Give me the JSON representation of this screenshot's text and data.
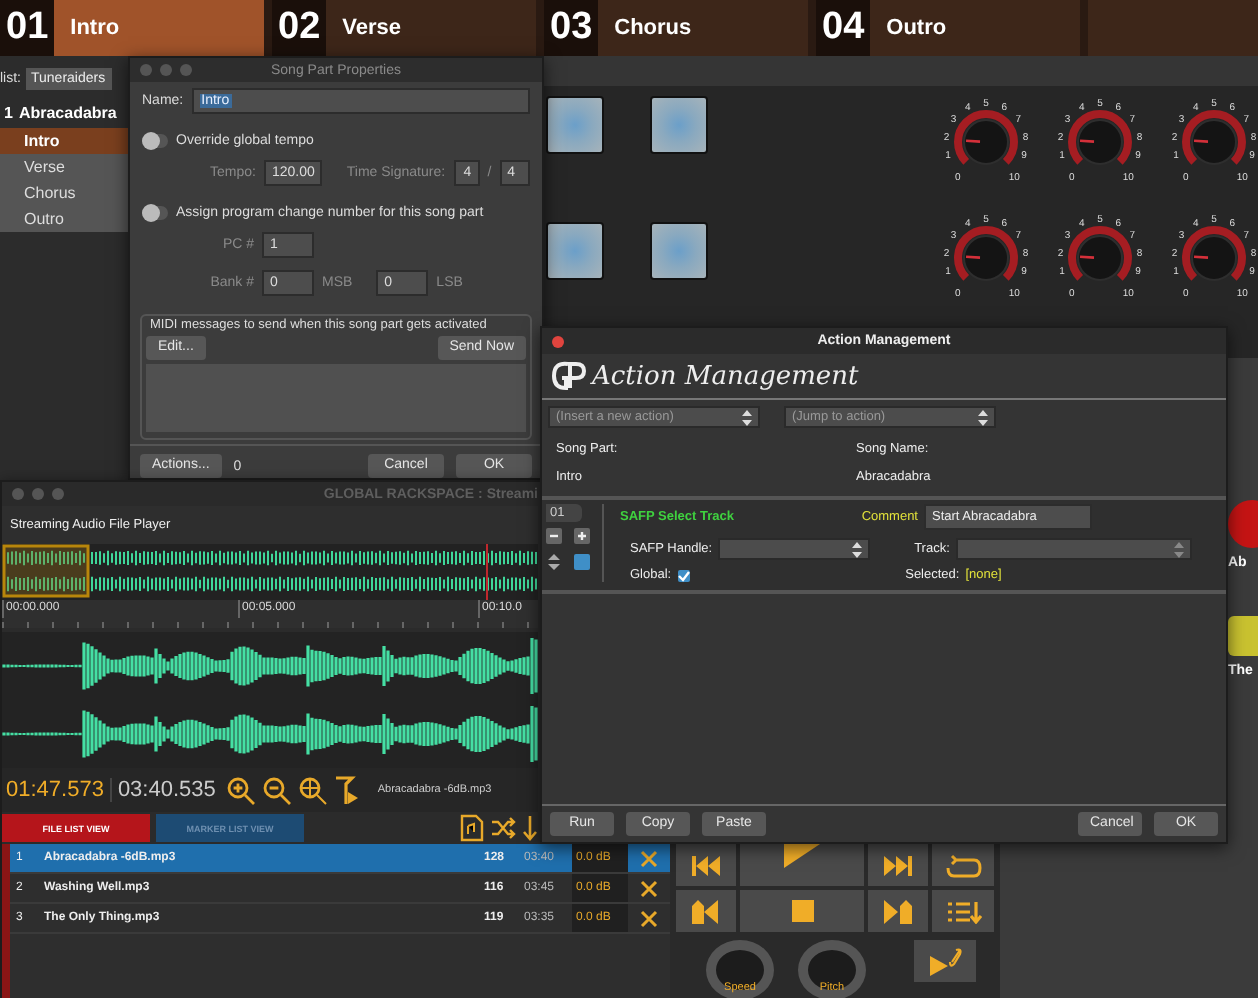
{
  "song_parts": [
    {
      "number": "01",
      "name": "Intro",
      "selected": true
    },
    {
      "number": "02",
      "name": "Verse",
      "selected": false
    },
    {
      "number": "03",
      "name": "Chorus",
      "selected": false
    },
    {
      "number": "04",
      "name": "Outro",
      "selected": false
    }
  ],
  "setlist": {
    "label": "list:",
    "value": "Tuneraiders",
    "song_number": "1",
    "song_name": "Abracadabra",
    "parts": [
      {
        "name": "Intro",
        "selected": true
      },
      {
        "name": "Verse",
        "selected": false
      },
      {
        "name": "Chorus",
        "selected": false
      },
      {
        "name": "Outro",
        "selected": false
      }
    ]
  },
  "knobs": [
    {
      "scale": [
        "0",
        "1",
        "2",
        "3",
        "4",
        "5",
        "6",
        "7",
        "8",
        "9",
        "10"
      ]
    },
    {
      "scale": [
        "0",
        "1",
        "2",
        "3",
        "4",
        "5",
        "6",
        "7",
        "8",
        "9",
        "10"
      ]
    },
    {
      "scale": [
        "0",
        "1",
        "2",
        "3",
        "4",
        "5",
        "6",
        "7",
        "8",
        "9",
        "10"
      ]
    },
    {
      "scale": [
        "0",
        "1",
        "2",
        "3",
        "4",
        "5",
        "6",
        "7",
        "8",
        "9",
        "10"
      ]
    },
    {
      "scale": [
        "0",
        "1",
        "2",
        "3",
        "4",
        "5",
        "6",
        "7",
        "8",
        "9",
        "10"
      ]
    },
    {
      "scale": [
        "0",
        "1",
        "2",
        "3",
        "4",
        "5",
        "6",
        "7",
        "8",
        "9",
        "10"
      ]
    }
  ],
  "side_buttons": [
    {
      "label": "Ab",
      "color": "#c41414"
    },
    {
      "label": "The",
      "color": "#c9c230"
    }
  ],
  "song_part_dialog": {
    "title": "Song Part Properties",
    "name_label": "Name:",
    "name_value": "Intro",
    "override_tempo": {
      "label": "Override global tempo",
      "on": false
    },
    "tempo_label": "Tempo:",
    "tempo": "120.00",
    "time_signature_label": "Time Signature:",
    "ts_numerator": "4",
    "ts_separator": "/",
    "ts_denominator": "4",
    "program_change": {
      "label": "Assign program change number for this song part",
      "on": false
    },
    "pc_label": "PC #",
    "pc": "1",
    "bank_label": "Bank #",
    "msb": "0",
    "msb_label": "MSB",
    "lsb": "0",
    "lsb_label": "LSB",
    "midi_group": "MIDI messages to send when this song part gets activated",
    "edit_button": "Edit...",
    "send_button": "Send Now",
    "actions_button": "Actions...",
    "actions_count": "0",
    "cancel_button": "Cancel",
    "ok_button": "OK"
  },
  "rackspace": {
    "title": "GLOBAL RACKSPACE : Streami",
    "plugin": "Streaming Audio File Player",
    "timeline": [
      "00:00.000",
      "00:05.000",
      "00:10.0"
    ],
    "position": "01:47.573",
    "length": "03:40.535",
    "file": "Abracadabra -6dB.mp3",
    "tabs": [
      {
        "label": "FILE LIST VIEW",
        "selected": true
      },
      {
        "label": "MARKER LIST VIEW",
        "selected": false
      }
    ],
    "files": [
      {
        "number": "1",
        "name": "Abracadabra -6dB.mp3",
        "bpm": "128",
        "duration": "03:40",
        "gain": "0.0 dB",
        "selected": true
      },
      {
        "number": "2",
        "name": "Washing Well.mp3",
        "bpm": "116",
        "duration": "03:45",
        "gain": "0.0 dB",
        "selected": false
      },
      {
        "number": "3",
        "name": "The Only Thing.mp3",
        "bpm": "119",
        "duration": "03:35",
        "gain": "0.0 dB",
        "selected": false
      }
    ]
  },
  "action_dialog": {
    "title": "Action Management",
    "logo": "Action Management",
    "insert_select": "(Insert a new action)",
    "jump_select": "(Jump to action)",
    "song_part_label": "Song Part:",
    "song_part": "Intro",
    "song_name_label": "Song Name:",
    "song_name": "Abracadabra",
    "actions": [
      {
        "index": "01",
        "type": "SAFP Select Track",
        "comment_label": "Comment",
        "comment": "Start Abracadabra",
        "handle_label": "SAFP Handle:",
        "track_label": "Track:",
        "global_label": "Global:",
        "global": true,
        "selected_label": "Selected:",
        "selected_value": "[none]"
      }
    ],
    "buttons_left": [
      "Run",
      "Copy",
      "Paste"
    ],
    "buttons_right": [
      "Cancel",
      "OK"
    ]
  },
  "transport": {
    "knobs": [
      "Speed",
      "Pitch"
    ]
  }
}
